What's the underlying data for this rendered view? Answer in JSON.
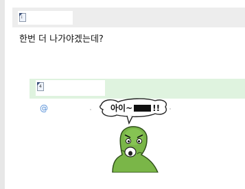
{
  "top": {
    "badge_letter": "i"
  },
  "post": {
    "text": "한번 더 나가야겠는데?"
  },
  "reply": {
    "badge_letter": "4"
  },
  "sticker": {
    "speech_prefix": "아이~",
    "speech_suffix": "!!"
  },
  "icons": [
    "user-badge-icon",
    "at-icon"
  ]
}
